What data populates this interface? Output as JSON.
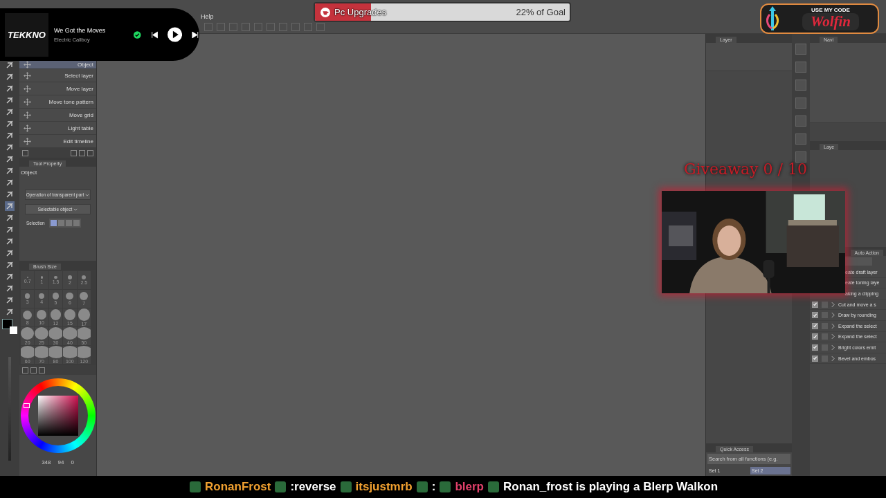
{
  "menu": [
    "Help"
  ],
  "music_player": {
    "album_art": "TEKKNO",
    "title": "We Got the Moves",
    "artist": "Electric Callboy",
    "liked": true,
    "playing": false
  },
  "goal_bar": {
    "label": "Pc Upgrades",
    "reading": "22% of Goal",
    "level": 0.22
  },
  "code_banner": {
    "caption": "USE MY CODE",
    "code": "Wolfin"
  },
  "giveaway": "Giveaway 0 / 10",
  "webcam": {
    "kind": "picture"
  },
  "sub_tools": [
    {
      "label": "Object",
      "selected": true
    },
    {
      "label": "Select layer",
      "selected": false
    },
    {
      "label": "Move layer",
      "selected": false
    },
    {
      "label": "Move tone pattern",
      "selected": false
    },
    {
      "label": "Move grid",
      "selected": false
    },
    {
      "label": "Light table",
      "selected": false
    },
    {
      "label": "Edit timeline",
      "selected": false
    }
  ],
  "tool_property": {
    "tab": "Tool Property",
    "heading": "Object",
    "dropdowns": [
      "Operation of transparent part",
      "Selectable object"
    ],
    "selection_label": "Selection"
  },
  "brush_size": {
    "tab": "Brush Size",
    "sizes": [
      "0.7",
      "1",
      "1.5",
      "2",
      "2.5",
      "3",
      "4",
      "5",
      "6",
      "7",
      "8",
      "10",
      "12",
      "15",
      "17",
      "20",
      "25",
      "30",
      "40",
      "50",
      "60",
      "70",
      "80",
      "100",
      "120"
    ]
  },
  "color_readout": [
    "348",
    "94",
    "0"
  ],
  "layer_panel": {
    "tab": "Layer"
  },
  "navigator": {
    "tab": "Navi",
    "layer_tab": "Laye"
  },
  "quick_access": {
    "tab": "Quick Access",
    "placeholder": "Search from all functions (e.g.",
    "sets": [
      {
        "label": "Set 1",
        "selected": false
      },
      {
        "label": "Set 2",
        "selected": true
      }
    ]
  },
  "auto_action": {
    "tab": "Auto Action",
    "items": [
      {
        "label": "eate draft layer",
        "kind": "partial"
      },
      {
        "label": "eate toning laye",
        "kind": "partial"
      },
      {
        "label": "aking a clipping",
        "kind": "partial"
      },
      {
        "label": "Cut and move a s",
        "kind": "full",
        "checked": true,
        "dialog": false
      },
      {
        "label": "Draw by rounding",
        "kind": "full",
        "checked": true,
        "dialog": false
      },
      {
        "label": "Expand the select",
        "kind": "full",
        "checked": true,
        "dialog": false
      },
      {
        "label": "Expand the select",
        "kind": "full",
        "checked": true,
        "dialog": false
      },
      {
        "label": "Bright colors emit",
        "kind": "full",
        "checked": true,
        "dialog": false
      },
      {
        "label": "Bevel and embos",
        "kind": "full",
        "checked": true,
        "dialog": false
      }
    ]
  },
  "tools": [
    {
      "selected": false
    },
    {
      "selected": false
    },
    {
      "selected": false
    },
    {
      "selected": false
    },
    {
      "selected": false
    },
    {
      "selected": false
    },
    {
      "selected": false
    },
    {
      "selected": false
    },
    {
      "selected": false
    },
    {
      "selected": false
    },
    {
      "selected": false
    },
    {
      "selected": false
    },
    {
      "selected": true
    },
    {
      "selected": false
    },
    {
      "selected": false
    },
    {
      "selected": false
    },
    {
      "selected": false
    },
    {
      "selected": false
    },
    {
      "selected": false
    },
    {
      "selected": false
    },
    {
      "selected": false
    },
    {
      "selected": false
    }
  ],
  "ticker": [
    {
      "text": "RonanFrost",
      "color": "#f0a030"
    },
    {
      "text": ":reverse",
      "color": "#ffffff"
    },
    {
      "text": "itsjustmrb",
      "color": "#f0a030"
    },
    {
      "text": ":",
      "color": "#ffffff"
    },
    {
      "text": "blerp",
      "color": "#e0406a"
    },
    {
      "text": "Ronan_frost is playing a Blerp Walkon",
      "color": "#ffffff"
    }
  ]
}
